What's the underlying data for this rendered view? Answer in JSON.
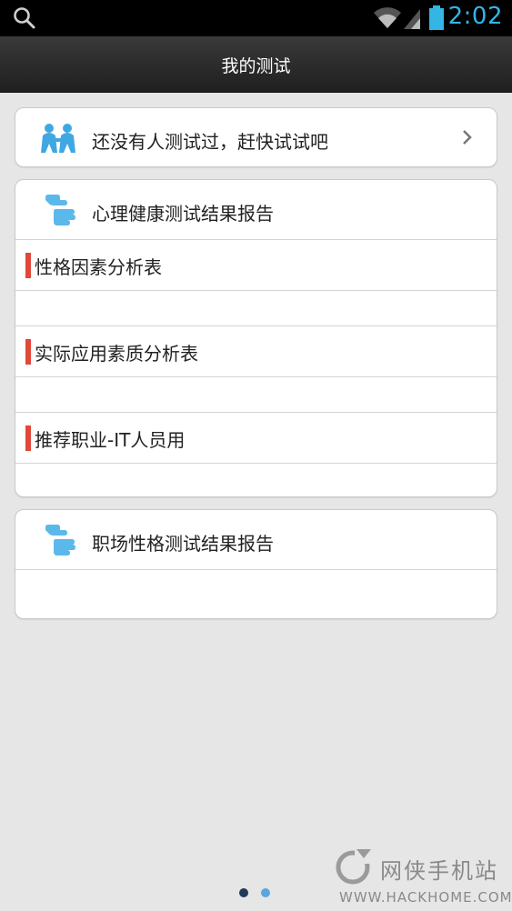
{
  "status_bar": {
    "time": "2:02",
    "icons": [
      "search-icon",
      "wifi-icon",
      "signal-icon",
      "battery-icon"
    ],
    "accent_color": "#33b5e5"
  },
  "header": {
    "title": "我的测试"
  },
  "empty_card": {
    "label": "还没有人测试过，赶快试试吧",
    "icon": "people-icon",
    "chevron": "chevron-right-icon"
  },
  "health_report": {
    "title": "心理健康测试结果报告",
    "icon": "hand-icon",
    "items": [
      {
        "label": "性格因素分析表"
      },
      {
        "label": "实际应用素质分析表"
      },
      {
        "label": "推荐职业-IT人员用"
      }
    ],
    "marker_color": "#e0483a"
  },
  "work_report": {
    "title": "职场性格测试结果报告",
    "icon": "hand-icon"
  },
  "watermark": {
    "name": "网侠手机站",
    "url": "WWW.HACKHOME.COM"
  },
  "pager": {
    "total": 2,
    "active": 1
  }
}
